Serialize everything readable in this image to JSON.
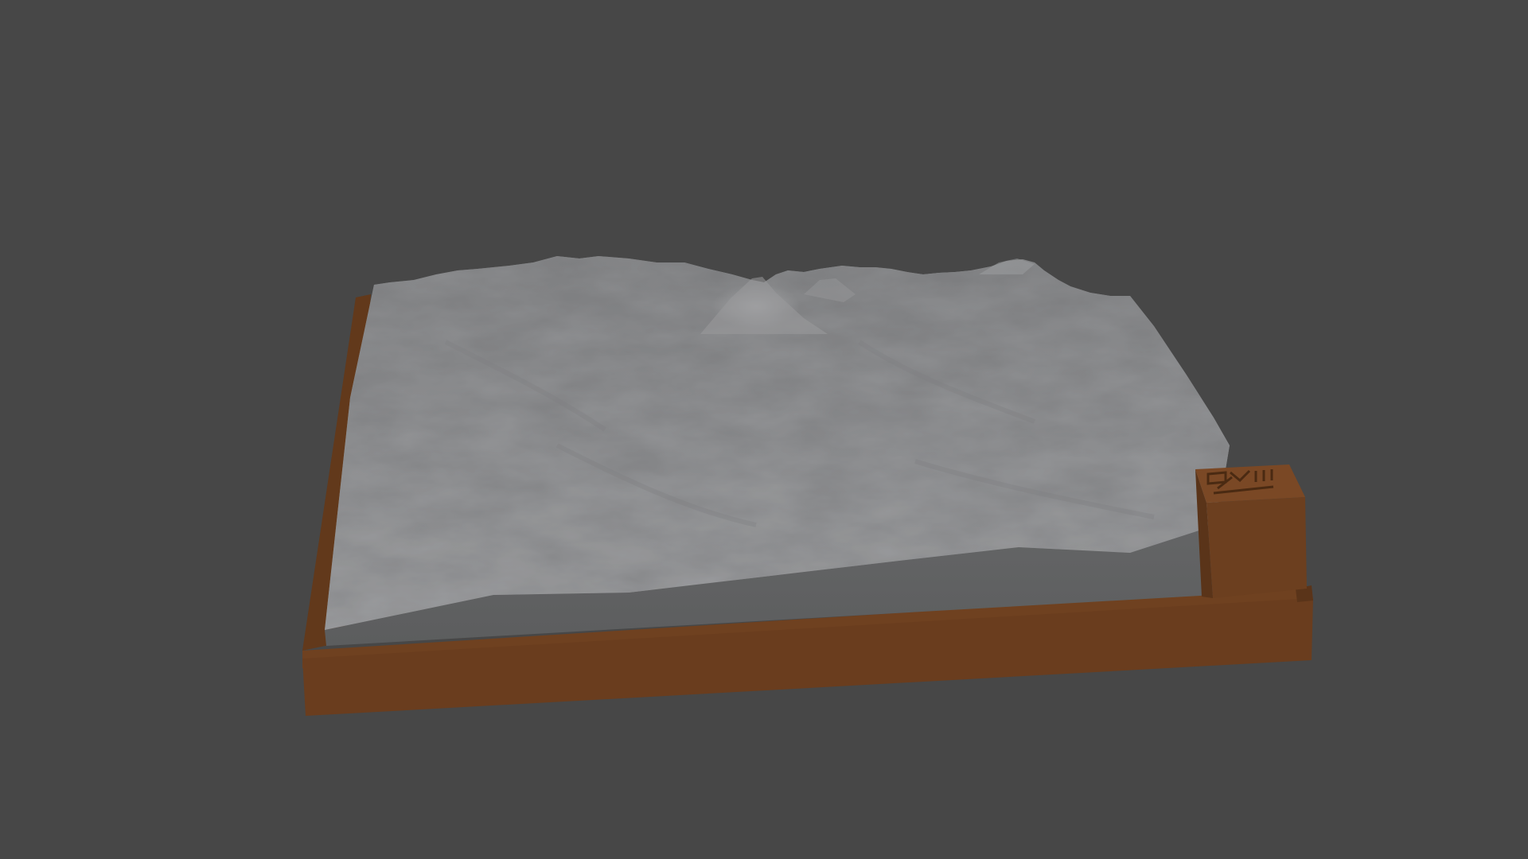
{
  "scene": {
    "background_color": "#474747",
    "base_color": "#6b3f1f",
    "terrain_color": "#8c8d8f",
    "terrain_side_color": "#5f6061",
    "label_block": {
      "description_icon": "terrain-label-emblem-icon",
      "color": "#6b3f1f"
    }
  }
}
